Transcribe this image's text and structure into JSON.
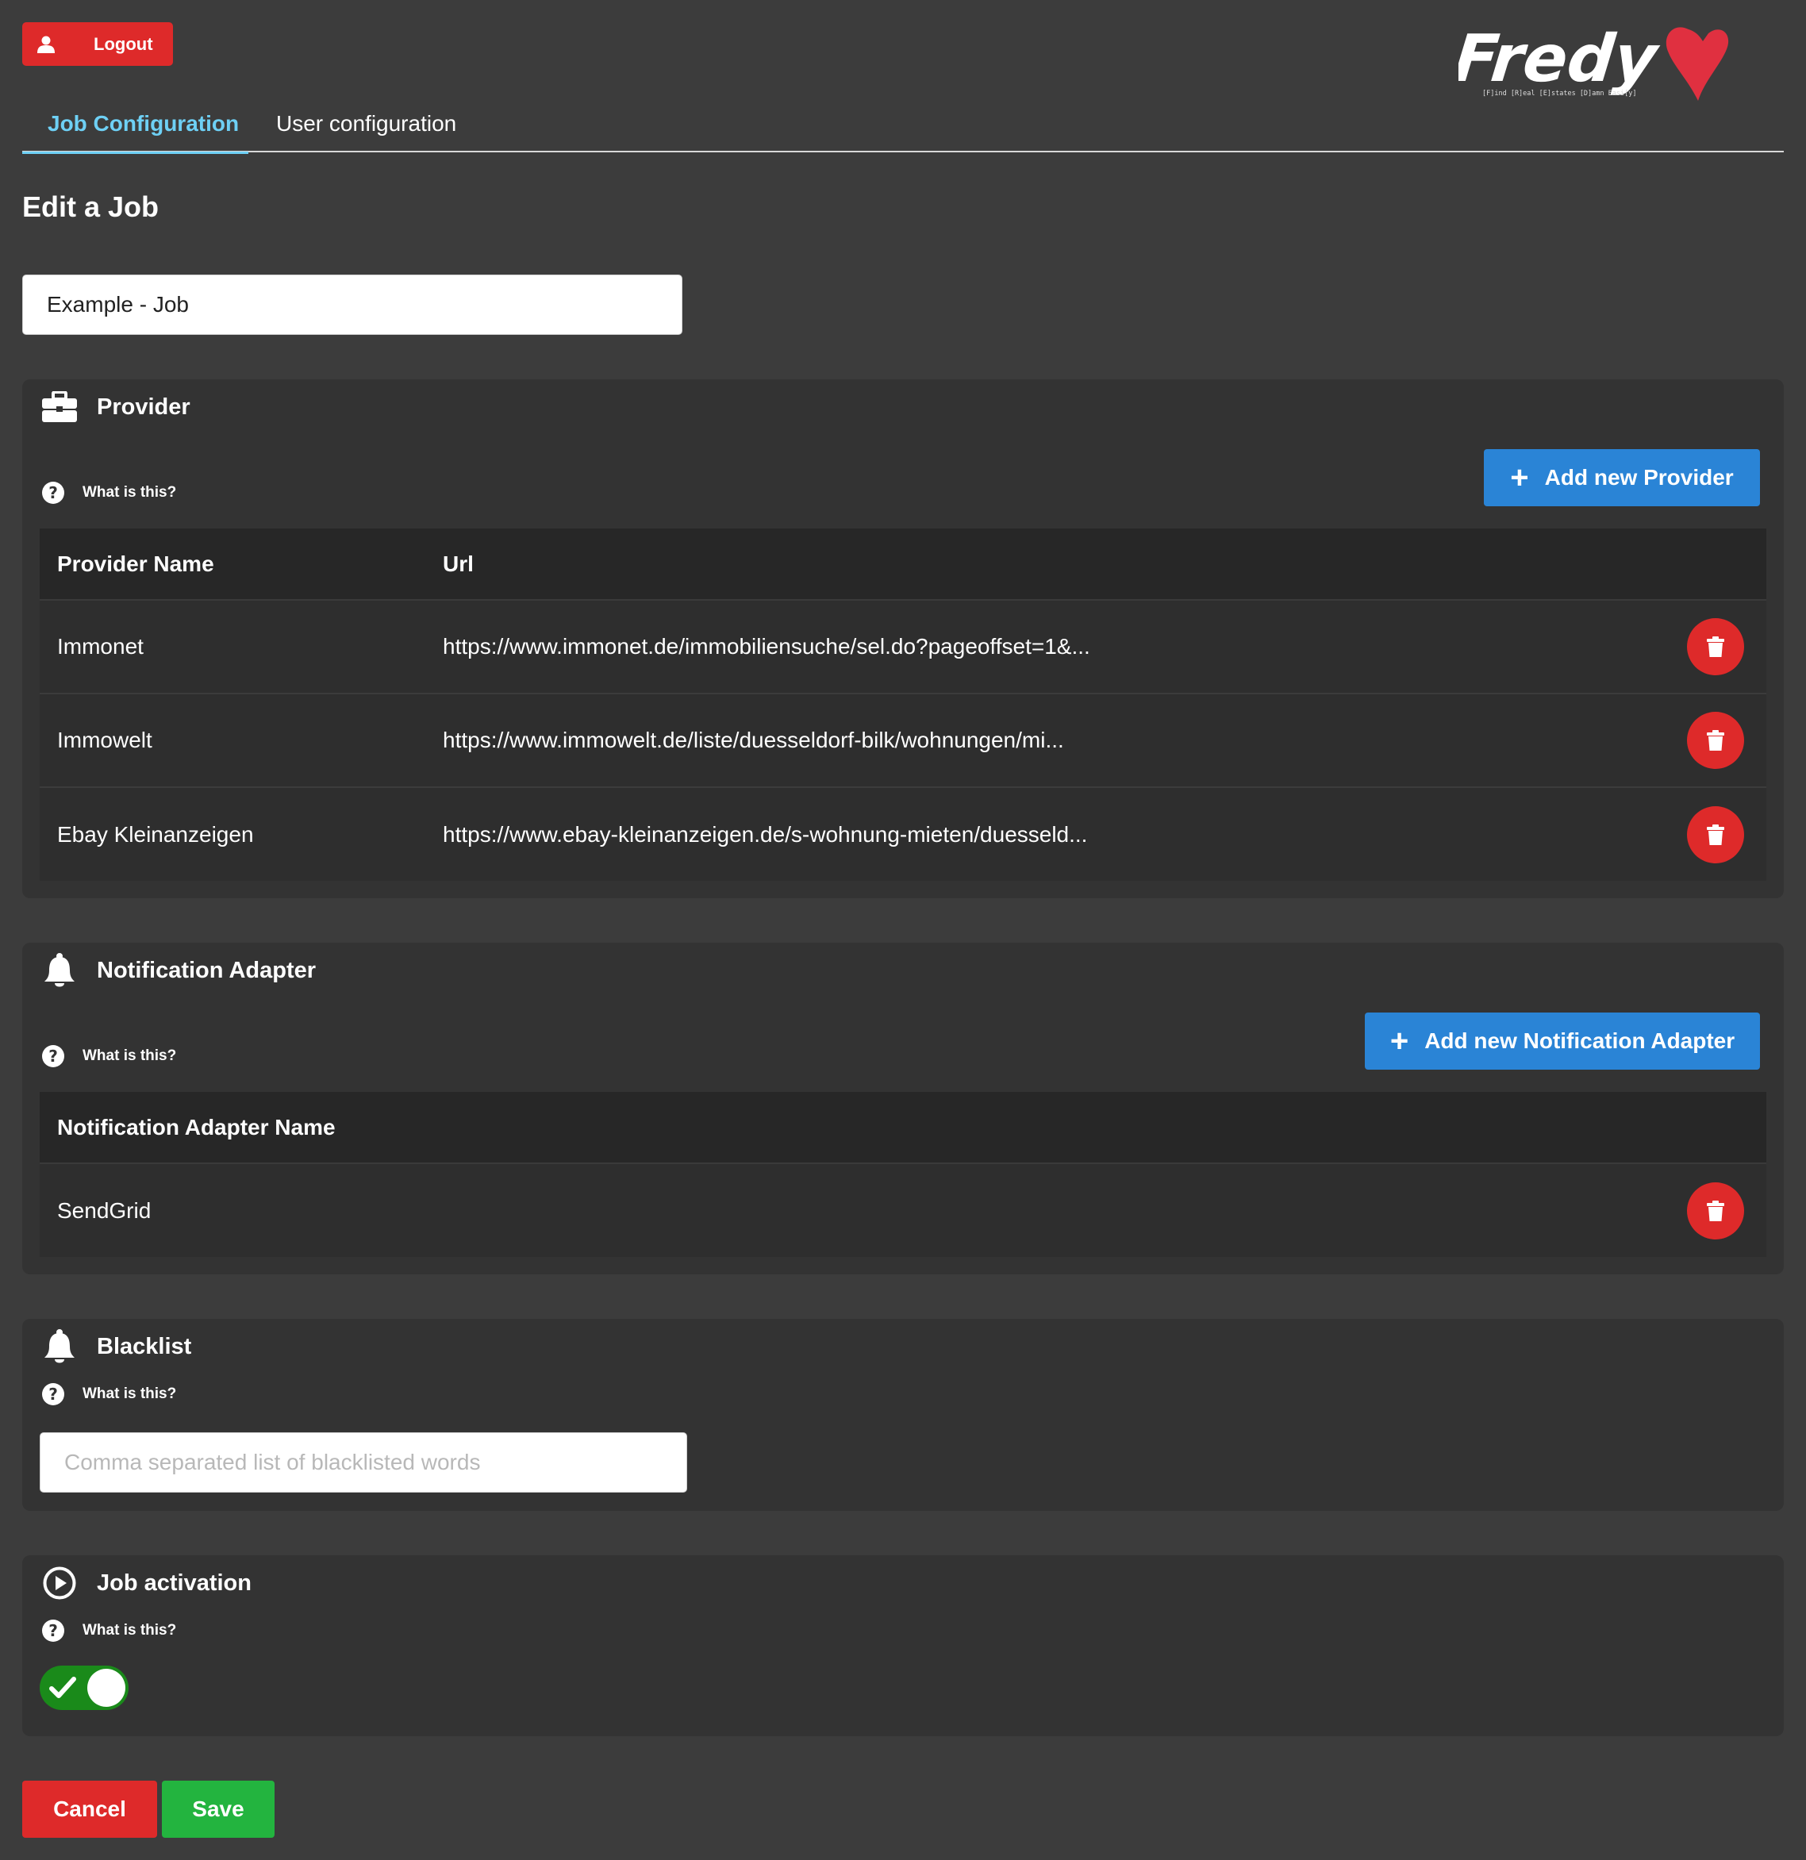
{
  "header": {
    "logout_label": "Logout",
    "logo_text": "Fredy",
    "logo_tagline": "[F]ind [R]eal [E]states [D]amn Easi[y]"
  },
  "tabs": [
    {
      "label": "Job Configuration",
      "active": true
    },
    {
      "label": "User configuration",
      "active": false
    }
  ],
  "page": {
    "title": "Edit a Job",
    "job_name_value": "Example - Job"
  },
  "help_label": "What is this?",
  "provider": {
    "title": "Provider",
    "icon": "briefcase-icon",
    "add_label": "Add new Provider",
    "columns": [
      "Provider Name",
      "Url"
    ],
    "rows": [
      {
        "name": "Immonet",
        "url": "https://www.immonet.de/immobiliensuche/sel.do?pageoffset=1&..."
      },
      {
        "name": "Immowelt",
        "url": "https://www.immowelt.de/liste/duesseldorf-bilk/wohnungen/mi..."
      },
      {
        "name": "Ebay Kleinanzeigen",
        "url": "https://www.ebay-kleinanzeigen.de/s-wohnung-mieten/duesseld..."
      }
    ]
  },
  "notification": {
    "title": "Notification Adapter",
    "icon": "bell-icon",
    "add_label": "Add new Notification Adapter",
    "columns": [
      "Notification Adapter Name"
    ],
    "rows": [
      {
        "name": "SendGrid"
      }
    ]
  },
  "blacklist": {
    "title": "Blacklist",
    "icon": "bell-icon",
    "placeholder": "Comma separated list of blacklisted words",
    "value": ""
  },
  "activation": {
    "title": "Job activation",
    "icon": "play-circle-icon",
    "enabled": true
  },
  "footer": {
    "cancel_label": "Cancel",
    "save_label": "Save"
  },
  "colors": {
    "background": "#3c3c3c",
    "panel": "#333333",
    "accent_tab": "#6ed0f5",
    "primary": "#2a84d6",
    "danger": "#de2a2a",
    "success": "#23b43f",
    "toggle_on": "#1a8a1a"
  }
}
